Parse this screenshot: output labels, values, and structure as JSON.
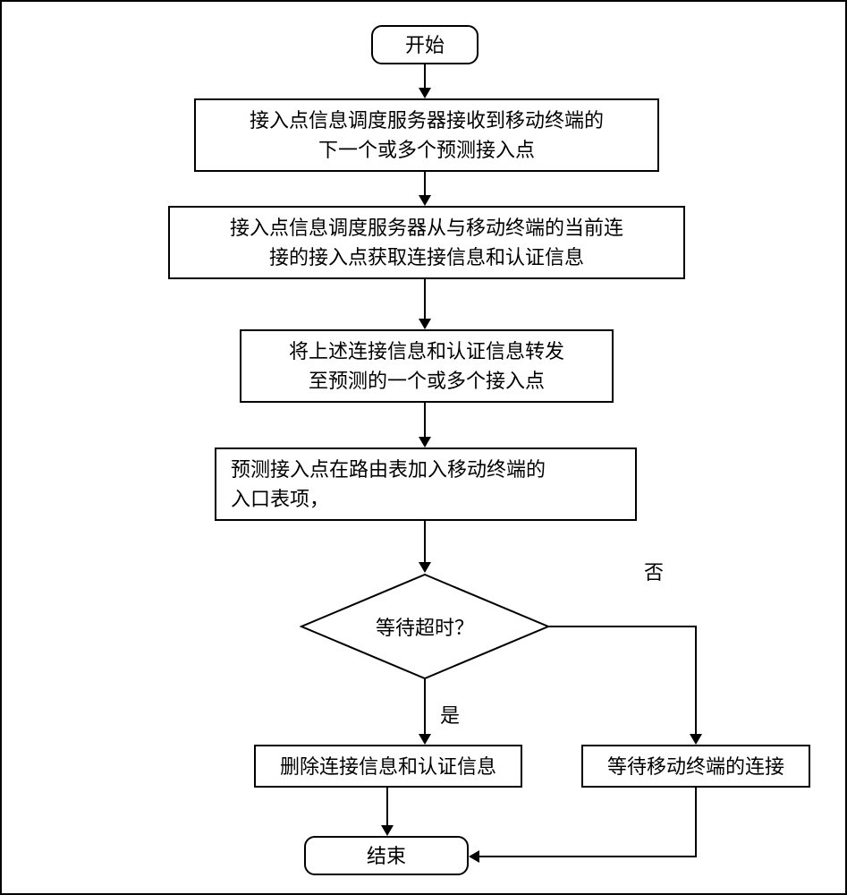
{
  "nodes": {
    "start": "开始",
    "receive": "接入点信息调度服务器接收到移动终端的\n下一个或多个预测接入点",
    "getinfo": "接入点信息调度服务器从与移动终端的当前连\n接的接入点获取连接信息和认证信息",
    "forward": "将上述连接信息和认证信息转发\n至预测的一个或多个接入点",
    "addentry": "预测接入点在路由表加入移动终端的\n入口表项，",
    "timeout": "等待超时？",
    "delete": "删除连接信息和认证信息",
    "wait": "等待移动终端的连接",
    "end": "结束"
  },
  "edges": {
    "yes": "是",
    "no": "否"
  }
}
